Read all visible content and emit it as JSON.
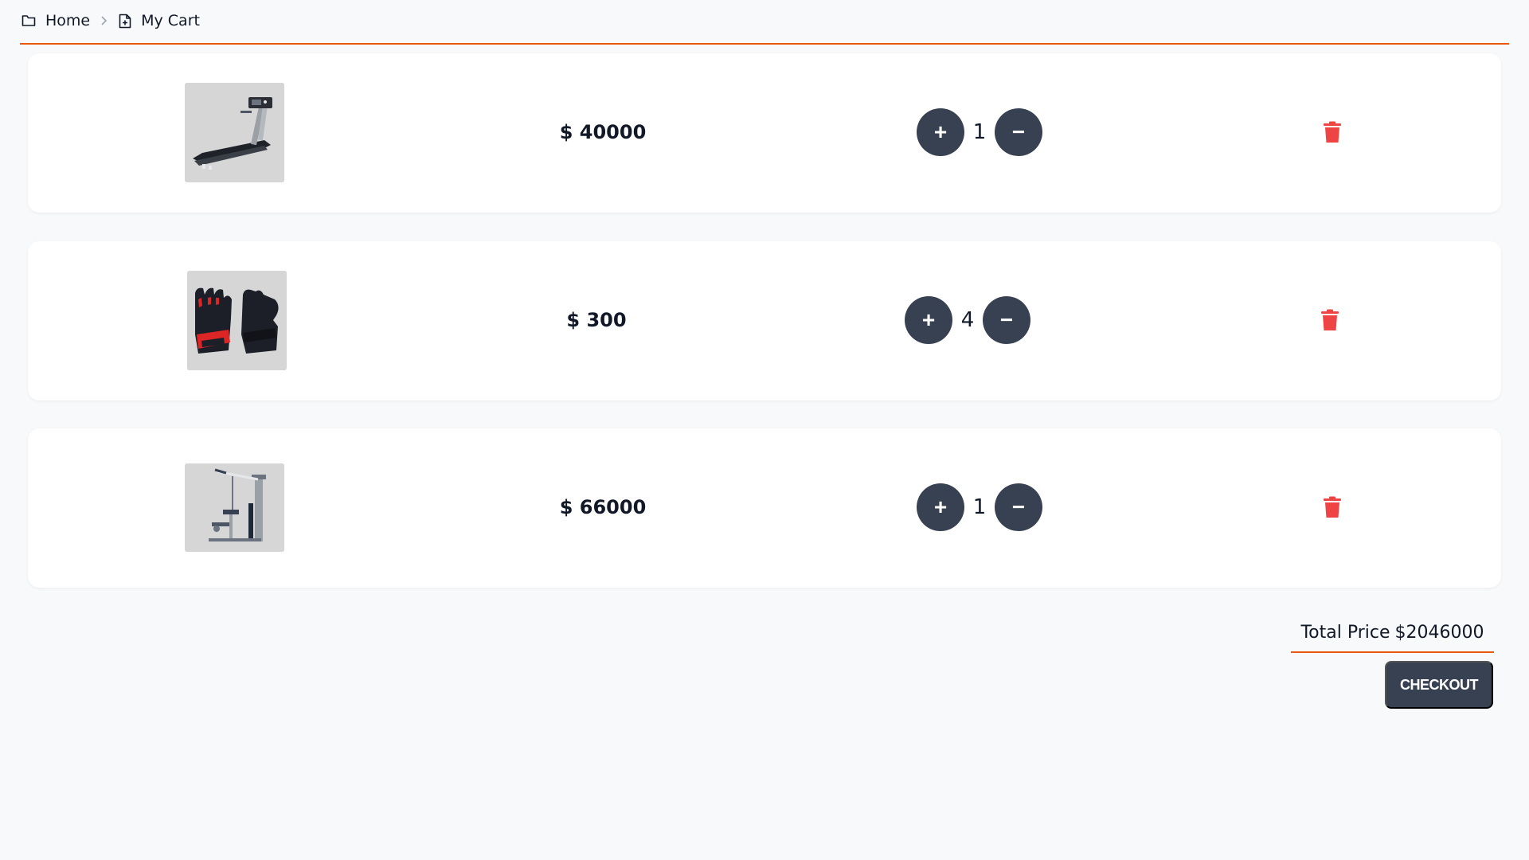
{
  "breadcrumb": {
    "home_label": "Home",
    "home_icon": "folder-icon",
    "separator_icon": "chevron-right-icon",
    "cart_label": "My Cart",
    "cart_icon": "file-plus-icon"
  },
  "cart_items": [
    {
      "image": "treadmill-image",
      "price": "$ 40000",
      "quantity": "1",
      "increment_label": "+",
      "decrement_label": "−"
    },
    {
      "image": "gloves-image",
      "price": "$ 300",
      "quantity": "4",
      "increment_label": "+",
      "decrement_label": "−"
    },
    {
      "image": "lat-pulldown-machine-image",
      "price": "$ 66000",
      "quantity": "1",
      "increment_label": "+",
      "decrement_label": "−"
    }
  ],
  "summary": {
    "total_label": "Total Price",
    "total_value": "$2046000",
    "checkout_label": "CHECKOUT"
  },
  "colors": {
    "accent": "#ea580c",
    "button_dark": "#374151",
    "delete": "#ef4444",
    "background": "#f8f9fb"
  }
}
